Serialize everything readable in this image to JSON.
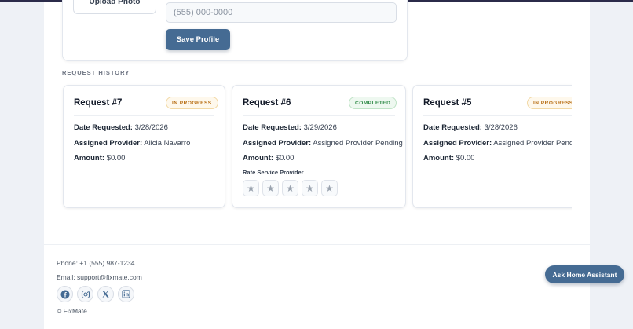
{
  "profile": {
    "upload_label": "Upload Photo",
    "phone_placeholder": "(555) 000-0000",
    "save_label": "Save Profile"
  },
  "history": {
    "title": "REQUEST HISTORY",
    "requests": [
      {
        "title": "Request #7",
        "status": "IN PROGRESS",
        "date_label": "Date Requested:",
        "date": "3/28/2026",
        "provider_label": "Assigned Provider:",
        "provider": "Alicia Navarro",
        "amount_label": "Amount:",
        "amount": "$0.00"
      },
      {
        "title": "Request #6",
        "status": "COMPLETED",
        "date_label": "Date Requested:",
        "date": "3/29/2026",
        "provider_label": "Assigned Provider:",
        "provider": "Assigned Provider Pending",
        "amount_label": "Amount:",
        "amount": "$0.00",
        "rate_label": "Rate Service Provider",
        "rating": 0,
        "rating_max": 5
      },
      {
        "title": "Request #5",
        "status": "IN PROGRESS",
        "date_label": "Date Requested:",
        "date": "3/28/2026",
        "provider_label": "Assigned Provider:",
        "provider": "Assigned Provider Pendin",
        "amount_label": "Amount:",
        "amount": "$0.00"
      }
    ]
  },
  "footer": {
    "phone": "Phone: +1 (555) 987-1234",
    "email": "Email: support@fixmate.com",
    "copyright": "© FixMate",
    "socials": [
      "facebook-icon",
      "instagram-icon",
      "x-icon",
      "linkedin-icon"
    ]
  },
  "assistant": {
    "label": "Ask Home Assistant"
  },
  "colors": {
    "accent": "#456b93",
    "in_progress": "#b86e14",
    "completed": "#2f8a47"
  }
}
